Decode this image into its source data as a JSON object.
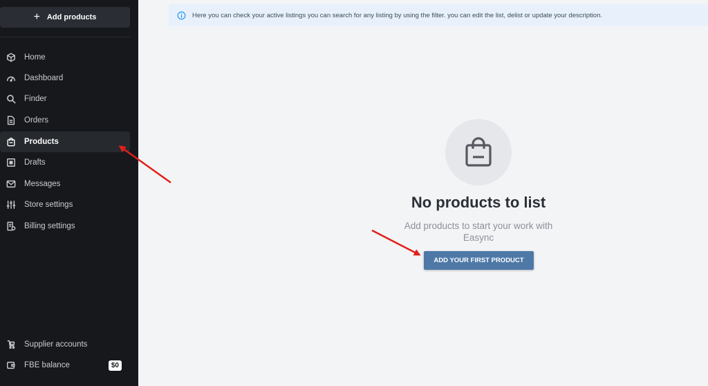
{
  "sidebar": {
    "add_button_label": "Add products",
    "items": [
      {
        "label": "Home",
        "icon": "cube-icon"
      },
      {
        "label": "Dashboard",
        "icon": "gauge-icon"
      },
      {
        "label": "Finder",
        "icon": "search-icon"
      },
      {
        "label": "Orders",
        "icon": "document-icon"
      },
      {
        "label": "Products",
        "icon": "bag-icon",
        "active": true
      },
      {
        "label": "Drafts",
        "icon": "draft-icon"
      },
      {
        "label": "Messages",
        "icon": "mail-icon"
      },
      {
        "label": "Store settings",
        "icon": "sliders-icon"
      },
      {
        "label": "Billing settings",
        "icon": "billing-icon"
      }
    ],
    "bottom_items": [
      {
        "label": "Supplier accounts",
        "icon": "supplier-icon"
      },
      {
        "label": "FBE balance",
        "icon": "wallet-icon",
        "badge": "$0"
      }
    ]
  },
  "info_bar": {
    "text": "Here you can check your active listings you can search for any listing by using the filter. you can edit the list, delist or update your description."
  },
  "empty_state": {
    "title": "No products to list",
    "subtitle": "Add products to start your work with Easync",
    "button_label": "ADD YOUR FIRST PRODUCT"
  },
  "colors": {
    "sidebar_bg": "#16181c",
    "accent": "#4e79a7",
    "annotation_arrow": "#e0201a"
  }
}
